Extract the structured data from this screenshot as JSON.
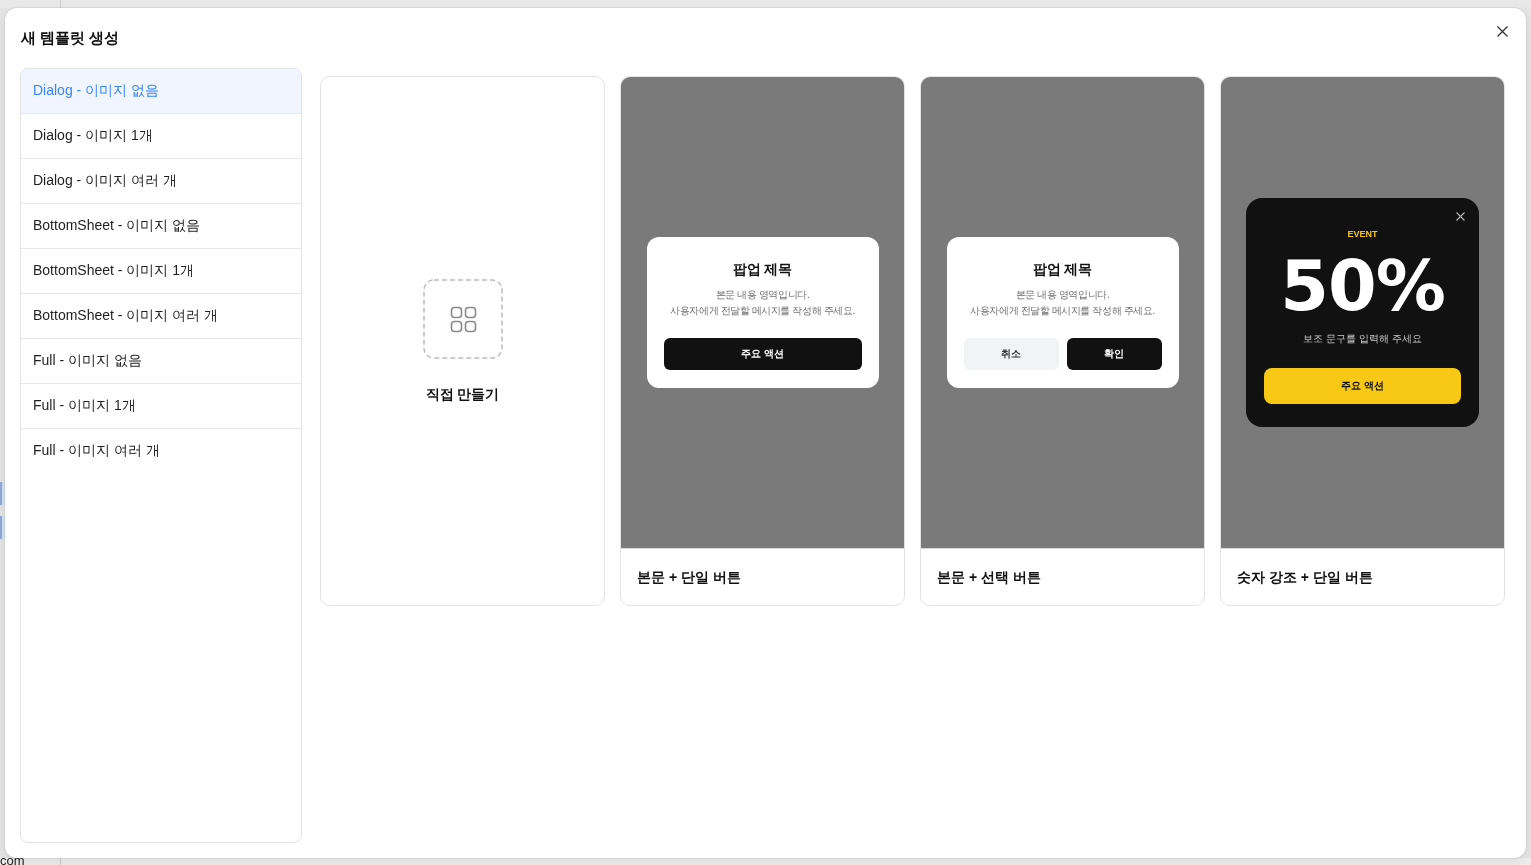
{
  "backdrop": {
    "rows": [
      {
        "selected": true
      },
      {
        "selected": true
      }
    ],
    "footer_text": "com"
  },
  "dialog": {
    "title": "새 템플릿 생성"
  },
  "sidebar": {
    "items": [
      {
        "label": "Dialog - 이미지 없음",
        "selected": true
      },
      {
        "label": "Dialog - 이미지 1개",
        "selected": false
      },
      {
        "label": "Dialog - 이미지 여러 개",
        "selected": false
      },
      {
        "label": "BottomSheet - 이미지 없음",
        "selected": false
      },
      {
        "label": "BottomSheet - 이미지 1개",
        "selected": false
      },
      {
        "label": "BottomSheet - 이미지 여러 개",
        "selected": false
      },
      {
        "label": "Full - 이미지 없음",
        "selected": false
      },
      {
        "label": "Full - 이미지 1개",
        "selected": false
      },
      {
        "label": "Full - 이미지 여러 개",
        "selected": false
      }
    ]
  },
  "templates": [
    {
      "kind": "blank",
      "label": "직접 만들기"
    },
    {
      "kind": "dialog",
      "label": "본문 + 단일 버튼",
      "preview": {
        "title": "팝업 제목",
        "body_lines": [
          "본문 내용 영역입니다.",
          "사용자에게 전달할 메시지를 작성해 주세요."
        ],
        "buttons": [
          {
            "kind": "primary",
            "label": "주요 액션"
          }
        ]
      }
    },
    {
      "kind": "dialog",
      "label": "본문 + 선택 버튼",
      "preview": {
        "title": "팝업 제목",
        "body_lines": [
          "본문 내용 영역입니다.",
          "사용자에게 전달할 메시지를 작성해 주세요."
        ],
        "buttons": [
          {
            "kind": "secondary",
            "label": "취소"
          },
          {
            "kind": "primary",
            "label": "확인"
          }
        ]
      }
    },
    {
      "kind": "promo",
      "label": "숫자 강조 + 단일 버튼",
      "preview": {
        "eyebrow": "EVENT",
        "headline": "50%",
        "subtext": "보조 문구를 입력해 주세요",
        "buttons": [
          {
            "kind": "accent",
            "label": "주요 액션"
          }
        ]
      }
    }
  ]
}
